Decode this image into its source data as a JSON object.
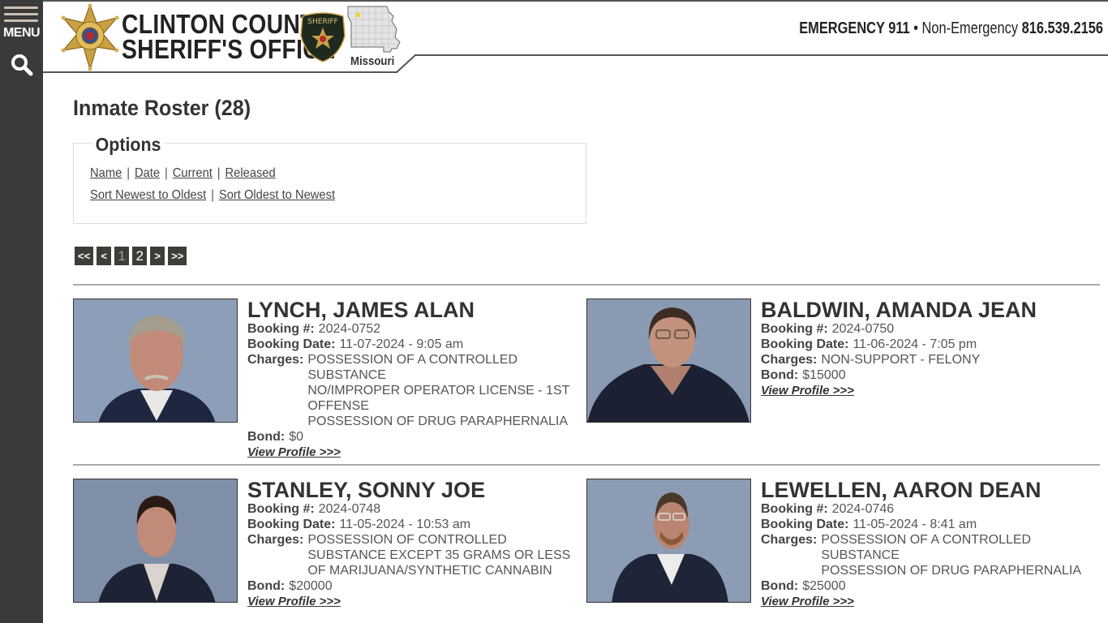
{
  "sidebar": {
    "menu_label": "MENU"
  },
  "header": {
    "title_line1": "CLINTON COUNTY",
    "title_line2": "SHERIFF'S OFFICE",
    "patch_text": "SHERIFF",
    "map_label": "Missouri",
    "emergency_label": "EMERGENCY 911",
    "bullet": "•",
    "non_emergency_label": "Non-Emergency",
    "non_emergency_phone": "816.539.2156"
  },
  "page": {
    "title": "Inmate Roster (28)"
  },
  "options": {
    "legend": "Options",
    "filter_links": [
      "Name",
      "Date",
      "Current",
      "Released"
    ],
    "sort_links": [
      "Sort Newest to Oldest",
      "Sort Oldest to Newest"
    ],
    "separator": "|"
  },
  "pagination": {
    "first": "<<",
    "prev": "<",
    "pages": [
      "1",
      "2"
    ],
    "current_page": "1",
    "next": ">",
    "last": ">>"
  },
  "labels": {
    "booking_number": "Booking #:",
    "booking_date": "Booking Date:",
    "charges": "Charges:",
    "bond": "Bond:",
    "view_profile": "View Profile >>>"
  },
  "inmates": [
    {
      "name": "LYNCH, JAMES ALAN",
      "booking_number": "2024-0752",
      "booking_date": "11-07-2024 - 9:05 am",
      "charges": [
        "POSSESSION OF A CONTROLLED SUBSTANCE",
        "NO/IMPROPER OPERATOR LICENSE - 1ST OFFENSE",
        "POSSESSION OF DRUG PARAPHERNALIA"
      ],
      "bond": "$0"
    },
    {
      "name": "BALDWIN, AMANDA JEAN",
      "booking_number": "2024-0750",
      "booking_date": "11-06-2024 - 7:05 pm",
      "charges": [
        "NON-SUPPORT - FELONY"
      ],
      "bond": "$15000"
    },
    {
      "name": "STANLEY, SONNY JOE",
      "booking_number": "2024-0748",
      "booking_date": "11-05-2024 - 10:53 am",
      "charges": [
        "POSSESSION OF CONTROLLED SUBSTANCE EXCEPT 35 GRAMS OR LESS OF MARIJUANA/SYNTHETIC CANNABIN"
      ],
      "bond": "$20000"
    },
    {
      "name": "LEWELLEN, AARON DEAN",
      "booking_number": "2024-0746",
      "booking_date": "11-05-2024 - 8:41 am",
      "charges": [
        "POSSESSION OF A CONTROLLED SUBSTANCE",
        "POSSESSION OF DRUG PARAPHERNALIA"
      ],
      "bond": "$25000"
    }
  ],
  "colors": {
    "sidebar_bg": "#3a3a3a",
    "pager_bg": "#3b3f37",
    "pager_current_text": "#a89f8c",
    "text_dark": "#333333",
    "photo_backdrop": "#8fa0b5"
  }
}
